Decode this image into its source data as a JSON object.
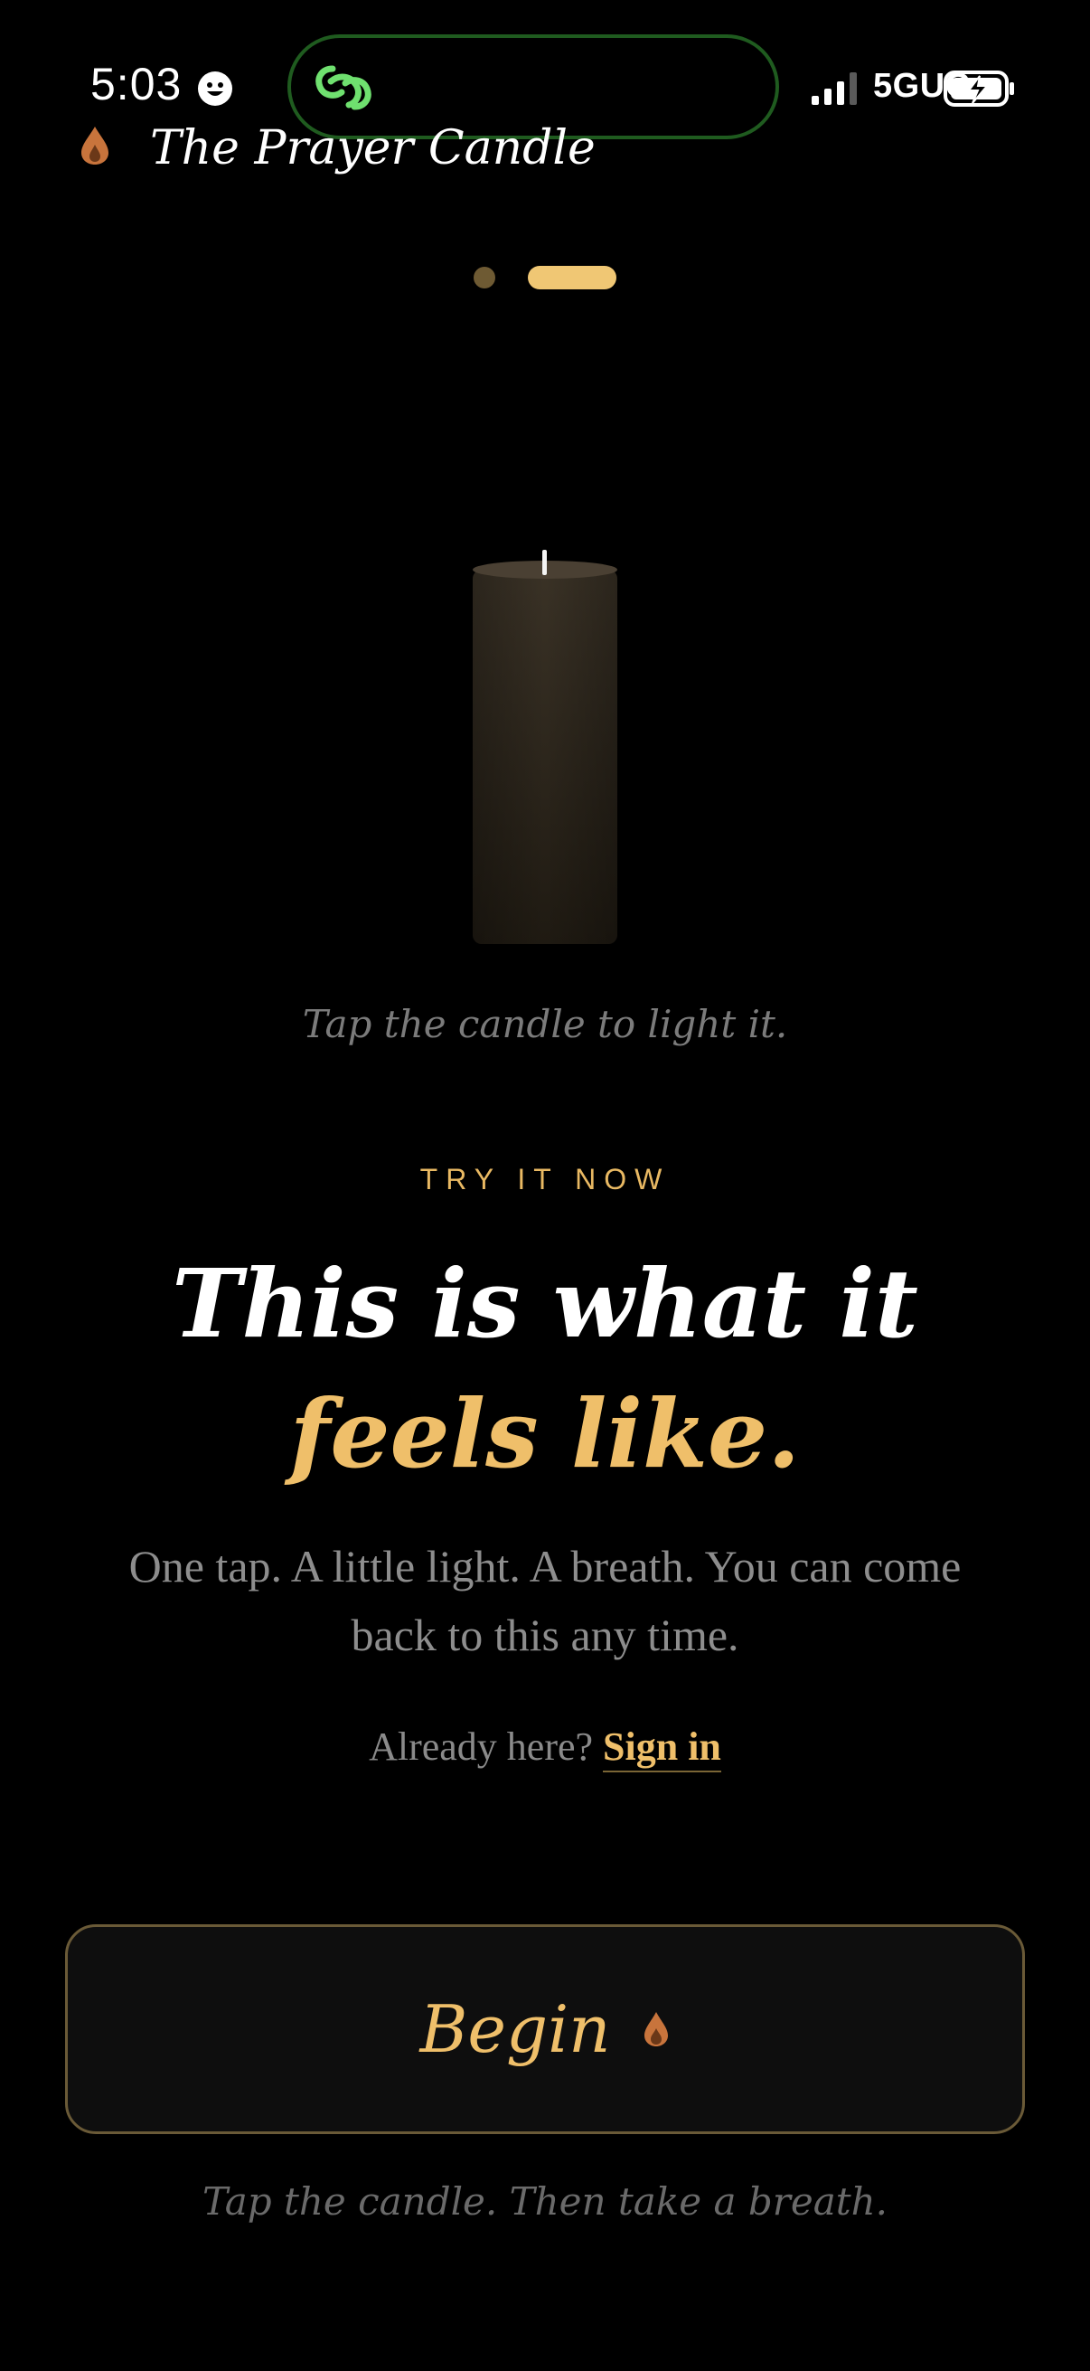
{
  "status_bar": {
    "time": "5:03",
    "network": "5GUC",
    "icons": [
      "smiley-face-icon",
      "link-chain-icon",
      "signal-bars-icon",
      "battery-charging-icon"
    ]
  },
  "header": {
    "app_title": "The Prayer Candle",
    "logo_icon": "flame-drop-icon"
  },
  "pager": {
    "total_pages": 2,
    "current_page": 2
  },
  "candle": {
    "state": "unlit",
    "hint": "Tap the candle to light it."
  },
  "intro": {
    "eyebrow": "TRY IT NOW",
    "headline_plain": "This is what it ",
    "headline_accent": "feels like.",
    "subtext": "One tap. A little light. A breath. You can come back to this any time."
  },
  "signin": {
    "prompt": "Already here? ",
    "link_label": "Sign in"
  },
  "cta": {
    "begin_label": "Begin",
    "icon": "flame-drop-icon",
    "footer_hint": "Tap the candle. Then take a breath."
  },
  "colors": {
    "background": "#000000",
    "accent_gold": "#efbf6a",
    "muted_text": "#8d8d8d",
    "button_border": "#6a5a37",
    "flame_drop": "#c8743c"
  }
}
